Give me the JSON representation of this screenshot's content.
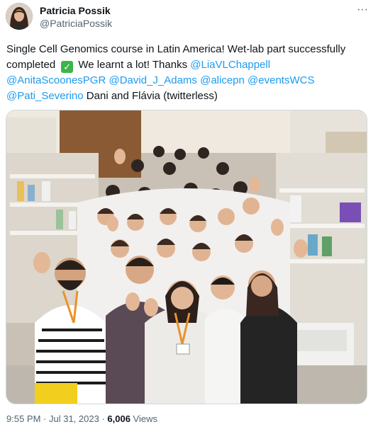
{
  "author": {
    "display_name": "Patricia Possik",
    "handle": "@PatriciaPossik"
  },
  "menu": {
    "more_label": "···",
    "more_icon": "more-horizontal-icon"
  },
  "tweet": {
    "line1": "Single Cell Genomics course in Latin America! Wet-lab part successfully",
    "line2_a": "completed",
    "check_glyph": "✓",
    "line2_b": "We learnt a lot! Thanks",
    "mentions": [
      "@LiaVLChappell",
      "@AnitaScoonesPGR",
      "@David_J_Adams",
      "@alicepn",
      "@eventsWCS",
      "@Pati_Severino"
    ],
    "line4_tail": "Dani and Flávia (twitterless)"
  },
  "media": {
    "kind": "group photo in laboratory"
  },
  "footer": {
    "time": "9:55 PM",
    "sep1": " · ",
    "date": "Jul 31, 2023",
    "sep2": " · ",
    "views_count": "6,006",
    "views_label": " Views"
  },
  "colors": {
    "link": "#1d9bf0",
    "text": "#0f1419",
    "muted": "#536471",
    "check_bg": "#3bb54a"
  }
}
